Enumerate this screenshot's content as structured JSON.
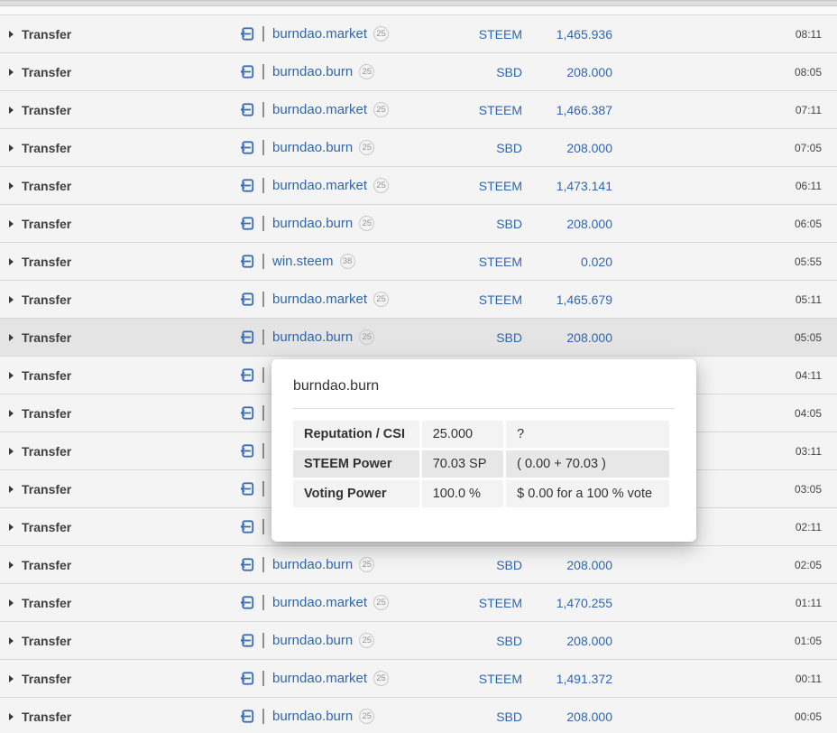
{
  "colors": {
    "link_blue": "#3066ad",
    "icon_blue": "#3a6db8",
    "row_bg": "#f4f4f4",
    "row_highlight": "#e4e4e4",
    "separator": "#d8d8d8",
    "page_bg": "#f9f9f9"
  },
  "icons": {
    "transfer_in": "box-arrow-in-left-icon",
    "expand": "triangle-right-icon"
  },
  "rows": [
    {
      "type": "Transfer",
      "account": "burndao.market",
      "rep": "25",
      "currency": "STEEM",
      "amount": "1,465.936",
      "time": "08:11",
      "highlighted": false
    },
    {
      "type": "Transfer",
      "account": "burndao.burn",
      "rep": "25",
      "currency": "SBD",
      "amount": "208.000",
      "time": "08:05",
      "highlighted": false
    },
    {
      "type": "Transfer",
      "account": "burndao.market",
      "rep": "25",
      "currency": "STEEM",
      "amount": "1,466.387",
      "time": "07:11",
      "highlighted": false
    },
    {
      "type": "Transfer",
      "account": "burndao.burn",
      "rep": "25",
      "currency": "SBD",
      "amount": "208.000",
      "time": "07:05",
      "highlighted": false
    },
    {
      "type": "Transfer",
      "account": "burndao.market",
      "rep": "25",
      "currency": "STEEM",
      "amount": "1,473.141",
      "time": "06:11",
      "highlighted": false
    },
    {
      "type": "Transfer",
      "account": "burndao.burn",
      "rep": "25",
      "currency": "SBD",
      "amount": "208.000",
      "time": "06:05",
      "highlighted": false
    },
    {
      "type": "Transfer",
      "account": "win.steem",
      "rep": "38",
      "currency": "STEEM",
      "amount": "0.020",
      "time": "05:55",
      "highlighted": false
    },
    {
      "type": "Transfer",
      "account": "burndao.market",
      "rep": "25",
      "currency": "STEEM",
      "amount": "1,465.679",
      "time": "05:11",
      "highlighted": false
    },
    {
      "type": "Transfer",
      "account": "burndao.burn",
      "rep": "25",
      "currency": "SBD",
      "amount": "208.000",
      "time": "05:05",
      "highlighted": true
    },
    {
      "type": "Transfer",
      "account": null,
      "rep": null,
      "currency": null,
      "amount": null,
      "time": "04:11",
      "highlighted": false
    },
    {
      "type": "Transfer",
      "account": null,
      "rep": null,
      "currency": null,
      "amount": null,
      "time": "04:05",
      "highlighted": false
    },
    {
      "type": "Transfer",
      "account": null,
      "rep": null,
      "currency": null,
      "amount": null,
      "time": "03:11",
      "highlighted": false
    },
    {
      "type": "Transfer",
      "account": null,
      "rep": null,
      "currency": null,
      "amount": null,
      "time": "03:05",
      "highlighted": false
    },
    {
      "type": "Transfer",
      "account": null,
      "rep": null,
      "currency": null,
      "amount": null,
      "time": "02:11",
      "highlighted": false
    },
    {
      "type": "Transfer",
      "account": "burndao.burn",
      "rep": "25",
      "currency": "SBD",
      "amount": "208.000",
      "time": "02:05",
      "highlighted": false
    },
    {
      "type": "Transfer",
      "account": "burndao.market",
      "rep": "25",
      "currency": "STEEM",
      "amount": "1,470.255",
      "time": "01:11",
      "highlighted": false
    },
    {
      "type": "Transfer",
      "account": "burndao.burn",
      "rep": "25",
      "currency": "SBD",
      "amount": "208.000",
      "time": "01:05",
      "highlighted": false
    },
    {
      "type": "Transfer",
      "account": "burndao.market",
      "rep": "25",
      "currency": "STEEM",
      "amount": "1,491.372",
      "time": "00:11",
      "highlighted": false
    },
    {
      "type": "Transfer",
      "account": "burndao.burn",
      "rep": "25",
      "currency": "SBD",
      "amount": "208.000",
      "time": "00:05",
      "highlighted": false
    }
  ],
  "popover": {
    "title": "burndao.burn",
    "rows": [
      {
        "label": "Reputation / CSI",
        "value": "25.000",
        "detail": "?"
      },
      {
        "label": "STEEM Power",
        "value": "70.03 SP",
        "detail": "( 0.00 + 70.03 )"
      },
      {
        "label": "Voting Power",
        "value": "100.0 %",
        "detail": "$ 0.00 for a 100 % vote"
      }
    ]
  }
}
